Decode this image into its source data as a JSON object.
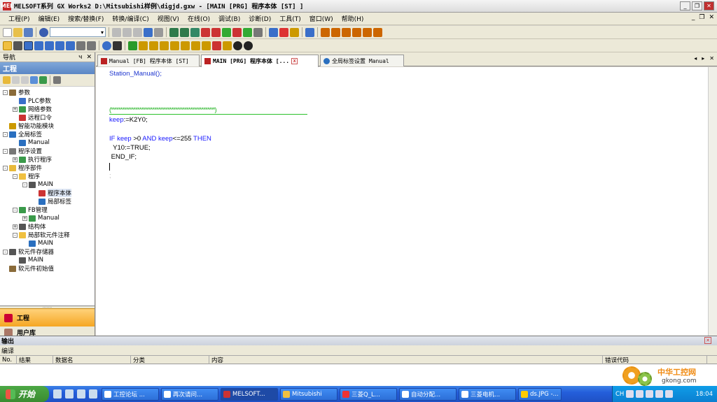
{
  "title": "MELSOFT系列 GX Works2 D:\\Mitsubishi样例\\digjd.gxw - [MAIN [PRG] 程序本体 [ST] ]",
  "app_icon": "MEL",
  "menu": [
    "工程(P)",
    "编辑(E)",
    "搜索/替换(F)",
    "转换/编译(C)",
    "视图(V)",
    "在线(O)",
    "调试(B)",
    "诊断(D)",
    "工具(T)",
    "窗口(W)",
    "帮助(H)"
  ],
  "nav": {
    "title": "导航",
    "pin": "ч",
    "close": "✕",
    "project_header": "工程",
    "tree": [
      {
        "label": "参数",
        "level": 0,
        "exp": "-",
        "icon": "params"
      },
      {
        "label": "PLC参数",
        "level": 1,
        "exp": "",
        "icon": "plc"
      },
      {
        "label": "网络参数",
        "level": 1,
        "exp": "+",
        "icon": "network"
      },
      {
        "label": "远程口令",
        "level": 1,
        "exp": "",
        "icon": "remote"
      },
      {
        "label": "智能功能模块",
        "level": 0,
        "exp": "",
        "icon": "module"
      },
      {
        "label": "全局标签",
        "level": 0,
        "exp": "-",
        "icon": "label"
      },
      {
        "label": "Manual",
        "level": 1,
        "exp": "",
        "icon": "global"
      },
      {
        "label": "程序设置",
        "level": 0,
        "exp": "-",
        "icon": "setting"
      },
      {
        "label": "执行程序",
        "level": 1,
        "exp": "+",
        "icon": "exec"
      },
      {
        "label": "程序部件",
        "level": 0,
        "exp": "-",
        "icon": "parts"
      },
      {
        "label": "程序",
        "level": 1,
        "exp": "-",
        "icon": "folder"
      },
      {
        "label": "MAIN",
        "level": 2,
        "exp": "-",
        "icon": "main"
      },
      {
        "label": "程序本体",
        "level": 3,
        "exp": "",
        "icon": "body",
        "selected": true
      },
      {
        "label": "局部标签",
        "level": 3,
        "exp": "",
        "icon": "local"
      },
      {
        "label": "FB管理",
        "level": 1,
        "exp": "-",
        "icon": "fb"
      },
      {
        "label": "Manual",
        "level": 2,
        "exp": "+",
        "icon": "fbitem"
      },
      {
        "label": "结构体",
        "level": 1,
        "exp": "+",
        "icon": "struct"
      },
      {
        "label": "局部软元件注释",
        "level": 1,
        "exp": "-",
        "icon": "comment"
      },
      {
        "label": "MAIN",
        "level": 2,
        "exp": "",
        "icon": "cmain"
      },
      {
        "label": "软元件存储器",
        "level": 0,
        "exp": "-",
        "icon": "memory"
      },
      {
        "label": "MAIN",
        "level": 1,
        "exp": "",
        "icon": "mmain"
      },
      {
        "label": "软元件初始值",
        "level": 0,
        "exp": "",
        "icon": "init"
      }
    ],
    "bottom_tab": "工程",
    "bottom_tab2": "用户库"
  },
  "tabs": [
    {
      "label": "Manual [FB] 程序本体 [ST]",
      "active": false
    },
    {
      "label": "MAIN [PRG] 程序本体 [...",
      "active": true
    },
    {
      "label": "全局标签设置 Manual",
      "active": false
    }
  ],
  "tab_nav": [
    "◂",
    "▸",
    "✕"
  ],
  "code": {
    "line1": "Station_Manual();",
    "comment": "(*******************************************************)",
    "keep_var": "keep",
    "keep_rest": ":=K2Y0;",
    "if_kw": "IF",
    "if_var1": " keep",
    "if_mid": " >0 ",
    "and_kw": "AND",
    "if_var2": " keep",
    "if_rest": "<=255 ",
    "then_kw": "THEN",
    "assign": "  Y10:=TRUE;",
    "endif": " END_IF;",
    "semicolon": ";"
  },
  "output": {
    "title": "输出",
    "sub": "编译",
    "columns": [
      "No.",
      "结果",
      "数据名",
      "分类",
      "内容",
      "错误代码"
    ],
    "close": "✕"
  },
  "watermark": {
    "line1": "中华工控网",
    "line2": "gkong.com"
  },
  "taskbar": {
    "start": "开始",
    "buttons": [
      "工控论坛 ...",
      "再次请问...",
      "MELSOFT...",
      "Mitsubishi",
      "三菱Q_L...",
      "自动分配...",
      "三菱电机...",
      "ds.JPG -..."
    ],
    "lang": "CH",
    "clock": "18:04"
  }
}
